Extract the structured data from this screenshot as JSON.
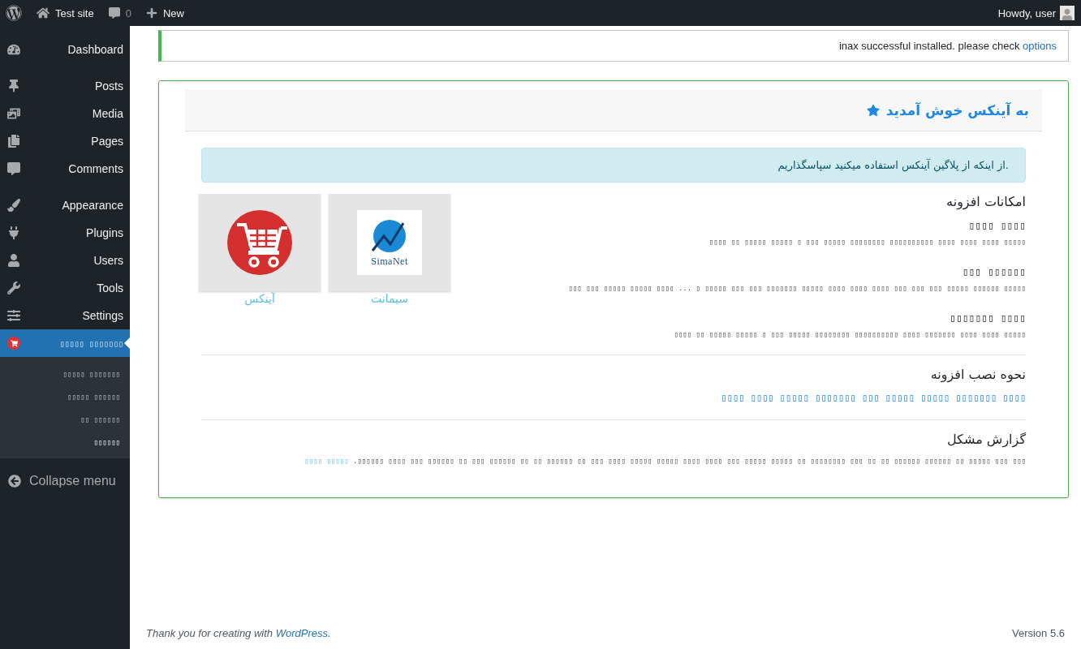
{
  "admin_bar": {
    "site_name": "Test site",
    "comments_count": "0",
    "new_label": "New",
    "greeting": "Howdy, user"
  },
  "sidebar": {
    "groups": [
      [
        {
          "label": "Dashboard",
          "selected": false
        }
      ],
      [
        {
          "label": "Posts",
          "selected": false
        },
        {
          "label": "Media",
          "selected": false
        },
        {
          "label": "Pages",
          "selected": false
        },
        {
          "label": "Comments",
          "selected": false
        }
      ],
      [
        {
          "label": "Appearance",
          "selected": false
        },
        {
          "label": "Plugins",
          "selected": false
        },
        {
          "label": "Users",
          "selected": false
        },
        {
          "label": "Tools",
          "selected": false
        },
        {
          "label": "Settings",
          "selected": false
        },
        {
          "label": "▯▯▯▯▯ ▯▯▯▯▯▯▯",
          "selected": true,
          "children": [
            {
              "label": "▯▯▯▯▯ ▯▯▯▯▯▯▯",
              "selected": false
            },
            {
              "label": "▯▯▯▯▯ ▯▯▯▯▯▯",
              "selected": false
            },
            {
              "label": "▯▯ ▯▯▯▯▯▯",
              "selected": false
            },
            {
              "label": "▯▯▯▯▯▯",
              "selected": true
            }
          ]
        }
      ]
    ],
    "collapse_label": "Collapse menu"
  },
  "notice": {
    "text": "inax successful installed. please check ",
    "link": "options"
  },
  "panel": {
    "title": "به آینکس خوش آمدید",
    "alert": ".از اینکه از پلاگین آینکس استفاده میکنید سپاسگذاریم",
    "features_heading": "امکانات افزونه",
    "features": [
      {
        "title": "▯▯▯▯ ▯▯▯▯",
        "desc": "▯▯▯▯▯ ▯▯▯▯ ▯▯▯▯ ▯▯▯▯ ▯▯▯▯▯▯▯▯▯▯ ▯▯▯▯▯▯▯▯ ▯▯▯▯▯ ▯▯▯ ▯ ▯▯▯▯▯ ▯▯▯▯▯ ▯▯ ▯▯▯▯"
      },
      {
        "title": "▯▯▯▯▯▯ ▯▯▯",
        "desc": "▯▯▯▯▯ ▯▯▯▯▯▯ ▯▯▯▯▯ ▯▯▯ ▯▯▯ ▯▯▯ ▯▯▯▯ ▯▯▯▯ ▯▯▯▯ ▯▯▯▯▯ ▯▯▯▯▯▯▯ ▯▯▯ ▯▯▯ ▯▯▯▯▯ ▯ ... ▯▯▯▯ ▯▯▯▯▯ ▯▯▯▯▯ ▯▯▯ ▯▯▯"
      },
      {
        "title": "▯▯▯▯ ▯▯▯▯▯▯▯",
        "desc": "▯▯▯▯▯ ▯▯▯▯ ▯▯▯▯ ▯▯▯▯▯▯▯ ▯▯▯▯ ▯▯▯▯▯▯▯▯▯▯ ▯▯▯▯▯▯▯▯ ▯▯▯▯▯ ▯▯▯ ▯ ▯▯▯▯▯ ▯▯▯▯▯ ▯▯ ▯▯▯▯"
      }
    ],
    "logo_tile": {
      "caption": "سیمانت",
      "logo_text": "SimaNet"
    },
    "cart_tile": {
      "caption": "آینکس"
    },
    "install_heading": "نحوه نصب افزونه",
    "install_link": "▯▯▯▯ ▯▯▯▯▯▯▯ ▯▯▯▯▯ ▯▯▯▯▯ ▯▯▯ ▯▯▯▯▯▯▯ ▯▯▯▯▯ ▯▯▯▯ ▯▯▯▯",
    "report_heading": "گزارش مشکل",
    "report_text": "▯▯▯ ▯▯▯ ▯▯▯▯▯ ▯▯ ▯▯▯▯▯▯ ▯▯▯▯▯▯ ▯▯ ▯▯ ▯▯▯ ▯▯▯▯▯▯▯▯ ▯▯ ▯▯▯▯▯ ▯▯▯▯▯ ▯▯▯ ▯▯▯▯ ▯▯▯▯ ▯▯▯▯▯ ▯▯▯▯▯ ▯▯▯▯ ▯▯▯ ▯▯ ▯▯▯▯▯▯ ▯▯ ▯▯ ▯▯▯▯▯▯ ▯▯▯ ▯▯ ▯▯▯▯▯▯ ▯▯▯ ▯▯▯▯ ▯▯▯▯▯▯.",
    "report_link": "▯▯▯▯▯ ▯▯▯▯"
  },
  "footer": {
    "before": "Thank you for creating with ",
    "link": "WordPress",
    "after": ".",
    "version": "Version 5.6"
  }
}
